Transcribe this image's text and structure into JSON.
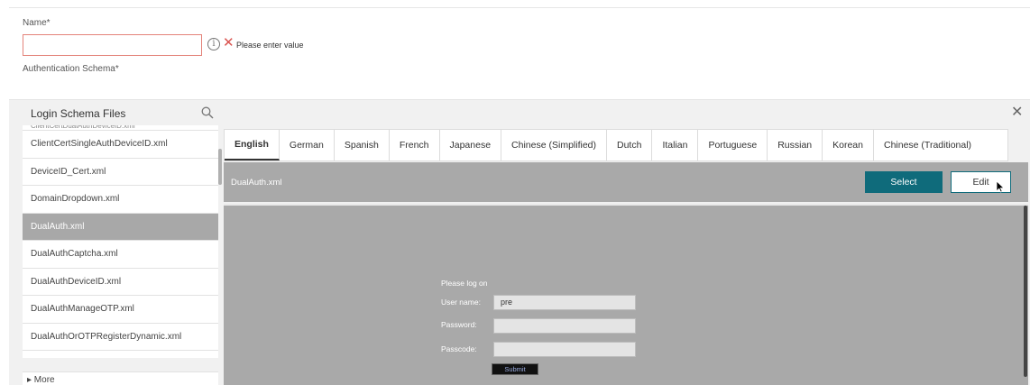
{
  "form": {
    "name_label": "Name*",
    "name_value": "",
    "info_glyph": "i",
    "error_glyph": "✕",
    "error_message": "Please enter value",
    "auth_schema_label": "Authentication Schema*"
  },
  "file_panel": {
    "title": "Login Schema Files",
    "close_glyph": "✕",
    "items": [
      {
        "label": "ClientCertDualAuthDeviceID.xml"
      },
      {
        "label": "ClientCertSingleAuthDeviceID.xml"
      },
      {
        "label": "DeviceID_Cert.xml"
      },
      {
        "label": "DomainDropdown.xml"
      },
      {
        "label": "DualAuth.xml"
      },
      {
        "label": "DualAuthCaptcha.xml"
      },
      {
        "label": "DualAuthDeviceID.xml"
      },
      {
        "label": "DualAuthManageOTP.xml"
      },
      {
        "label": "DualAuthOrOTPRegisterDynamic.xml"
      }
    ],
    "selected_index": 4,
    "more_label": "▸ More"
  },
  "languages": [
    "English",
    "German",
    "Spanish",
    "French",
    "Japanese",
    "Chinese (Simplified)",
    "Dutch",
    "Italian",
    "Portuguese",
    "Russian",
    "Korean",
    "Chinese (Traditional)"
  ],
  "active_language": "English",
  "preview": {
    "file_name": "DualAuth.xml",
    "select_label": "Select",
    "edit_label": "Edit",
    "logon_title": "Please log on",
    "username_label": "User name:",
    "username_value": "pre",
    "password_label": "Password:",
    "passcode_label": "Passcode:",
    "submit_label": "Submit"
  },
  "colors": {
    "accent": "#0f6b7b",
    "error": "#d9534f",
    "preview_bg": "#a9a9a9"
  }
}
